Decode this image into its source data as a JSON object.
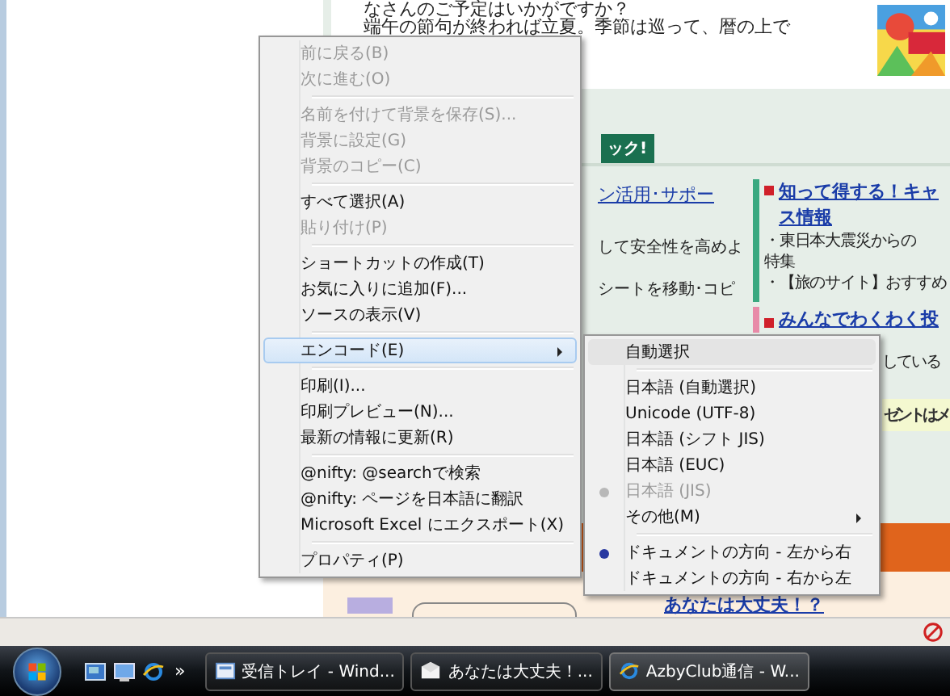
{
  "page": {
    "top_lines": [
      "なさんのご予定はいかがですか？",
      "端午の節句が終われば立夏。季節は巡って、暦の上で"
    ],
    "section_tag": "ック!",
    "left_column": [
      {
        "kind": "link",
        "text": "ン活用･サポー"
      },
      {
        "kind": "text",
        "text": "して安全性を高めよ"
      },
      {
        "kind": "text",
        "text": "シートを移動･コピ"
      }
    ],
    "right_title_lines": [
      "知って得する！キャ",
      "ス情報"
    ],
    "right_lines": [
      "・東日本大震災からの",
      "特集",
      "・【旅のサイト】おすすめ"
    ],
    "second_title": "みんなでわくわく投",
    "second_text": "している",
    "notice": "ゼントはメ",
    "bottom_link": "あなたは大丈夫！？"
  },
  "context_menu": {
    "items": [
      {
        "kind": "item",
        "label": "前に戻る(B)",
        "disabled": true,
        "selected": false,
        "submenu": false
      },
      {
        "kind": "item",
        "label": "次に進む(O)",
        "disabled": true,
        "selected": false,
        "submenu": false
      },
      {
        "kind": "separator"
      },
      {
        "kind": "item",
        "label": "名前を付けて背景を保存(S)...",
        "disabled": true,
        "selected": false,
        "submenu": false
      },
      {
        "kind": "item",
        "label": "背景に設定(G)",
        "disabled": true,
        "selected": false,
        "submenu": false
      },
      {
        "kind": "item",
        "label": "背景のコピー(C)",
        "disabled": true,
        "selected": false,
        "submenu": false
      },
      {
        "kind": "separator"
      },
      {
        "kind": "item",
        "label": "すべて選択(A)",
        "disabled": false,
        "selected": false,
        "submenu": false
      },
      {
        "kind": "item",
        "label": "貼り付け(P)",
        "disabled": true,
        "selected": false,
        "submenu": false
      },
      {
        "kind": "separator"
      },
      {
        "kind": "item",
        "label": "ショートカットの作成(T)",
        "disabled": false,
        "selected": false,
        "submenu": false
      },
      {
        "kind": "item",
        "label": "お気に入りに追加(F)...",
        "disabled": false,
        "selected": false,
        "submenu": false
      },
      {
        "kind": "item",
        "label": "ソースの表示(V)",
        "disabled": false,
        "selected": false,
        "submenu": false
      },
      {
        "kind": "separator"
      },
      {
        "kind": "item",
        "label": "エンコード(E)",
        "disabled": false,
        "selected": true,
        "submenu": true
      },
      {
        "kind": "separator"
      },
      {
        "kind": "item",
        "label": "印刷(I)...",
        "disabled": false,
        "selected": false,
        "submenu": false
      },
      {
        "kind": "item",
        "label": "印刷プレビュー(N)...",
        "disabled": false,
        "selected": false,
        "submenu": false
      },
      {
        "kind": "item",
        "label": "最新の情報に更新(R)",
        "disabled": false,
        "selected": false,
        "submenu": false
      },
      {
        "kind": "separator"
      },
      {
        "kind": "item",
        "label": "@nifty: @searchで検索",
        "disabled": false,
        "selected": false,
        "submenu": false
      },
      {
        "kind": "item",
        "label": "@nifty: ページを日本語に翻訳",
        "disabled": false,
        "selected": false,
        "submenu": false
      },
      {
        "kind": "item",
        "label": "Microsoft Excel にエクスポート(X)",
        "disabled": false,
        "selected": false,
        "submenu": false
      },
      {
        "kind": "separator"
      },
      {
        "kind": "item",
        "label": "プロパティ(P)",
        "disabled": false,
        "selected": false,
        "submenu": false
      }
    ]
  },
  "encoding_menu": {
    "items": [
      {
        "kind": "item",
        "label": "自動選択",
        "disabled": false,
        "selected": true,
        "checked": false,
        "submenu": false
      },
      {
        "kind": "separator"
      },
      {
        "kind": "item",
        "label": "日本語 (自動選択)",
        "disabled": false,
        "selected": false,
        "checked": false,
        "submenu": false
      },
      {
        "kind": "item",
        "label": "Unicode (UTF-8)",
        "disabled": false,
        "selected": false,
        "checked": false,
        "submenu": false
      },
      {
        "kind": "item",
        "label": "日本語 (シフト JIS)",
        "disabled": false,
        "selected": false,
        "checked": false,
        "submenu": false
      },
      {
        "kind": "item",
        "label": "日本語 (EUC)",
        "disabled": false,
        "selected": false,
        "checked": false,
        "submenu": false
      },
      {
        "kind": "item",
        "label": "日本語 (JIS)",
        "disabled": true,
        "selected": false,
        "checked": true,
        "submenu": false
      },
      {
        "kind": "item",
        "label": "その他(M)",
        "disabled": false,
        "selected": false,
        "checked": false,
        "submenu": true
      },
      {
        "kind": "separator"
      },
      {
        "kind": "item",
        "label": "ドキュメントの方向 - 左から右",
        "disabled": false,
        "selected": false,
        "checked": true,
        "submenu": false
      },
      {
        "kind": "item",
        "label": "ドキュメントの方向 - 右から左",
        "disabled": false,
        "selected": false,
        "checked": false,
        "submenu": false
      }
    ]
  },
  "taskbar": {
    "overflow": "»",
    "tasks": [
      {
        "label": "受信トレイ - Wind...",
        "kind": "mail",
        "selected": false
      },
      {
        "label": "あなたは大丈夫！...",
        "kind": "message",
        "selected": false
      },
      {
        "label": "AzbyClub通信 - W...",
        "kind": "browser",
        "selected": true
      }
    ]
  }
}
